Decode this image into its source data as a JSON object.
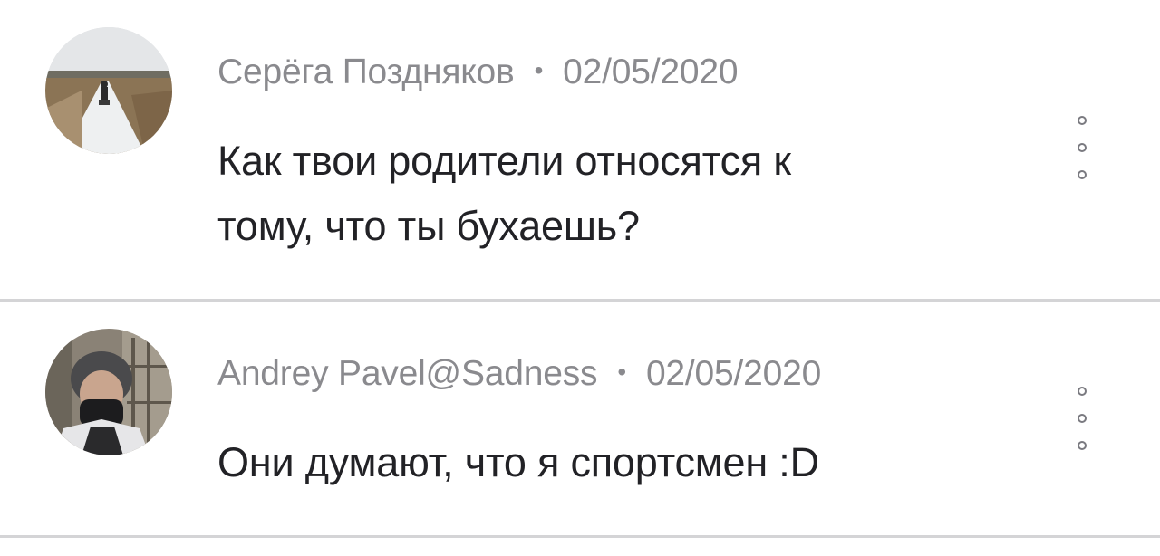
{
  "comments": [
    {
      "author": "Серёга Поздняков",
      "separator": "•",
      "date": "02/05/2020",
      "text_lines": [
        "Как твои родители относятся к",
        "тому, что ты бухаешь?"
      ],
      "avatar_icon": "user-photo-winter-field"
    },
    {
      "author": "Andrey Pavel@Sadness",
      "separator": "•",
      "date": "02/05/2020",
      "text_lines": [
        "Они думают, что я спортсмен :D"
      ],
      "avatar_icon": "user-photo-masked-man"
    }
  ],
  "icons": {
    "more": "more-options-icon"
  },
  "colors": {
    "meta_text": "#8a8a8e",
    "body_text": "#222226",
    "divider": "#d4d4d6",
    "background": "#ffffff"
  }
}
